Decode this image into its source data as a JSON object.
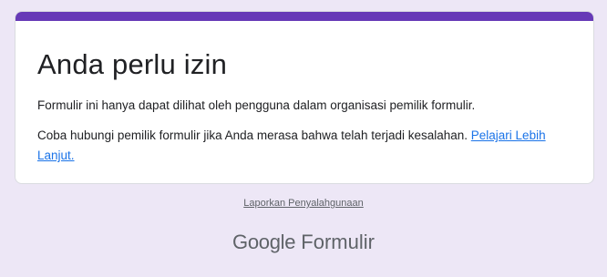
{
  "card": {
    "title": "Anda perlu izin",
    "message": "Formulir ini hanya dapat dilihat oleh pengguna dalam organisasi pemilik formulir.",
    "contact_text": "Coba hubungi pemilik formulir jika Anda merasa bahwa telah terjadi kesalahan. ",
    "learn_more_link": "Pelajari Lebih Lanjut."
  },
  "footer": {
    "report_abuse_link": "Laporkan Penyalahgunaan",
    "brand_google": "Google",
    "brand_product": "Formulir"
  },
  "colors": {
    "accent": "#673ab7",
    "background": "#ede7f6",
    "link": "#1a73e8"
  }
}
